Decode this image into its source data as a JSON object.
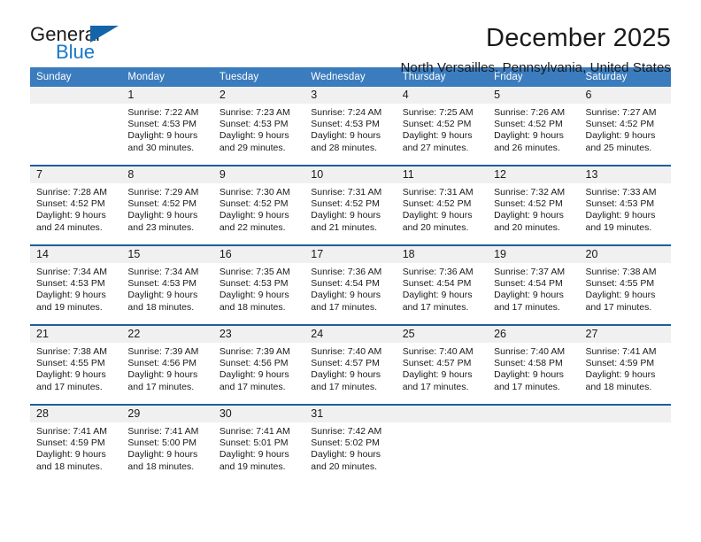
{
  "brand": {
    "name_part1": "General",
    "name_part2": "Blue",
    "accent_color": "#1878c8",
    "triangle_color": "#1464aa"
  },
  "header": {
    "title": "December 2025",
    "subtitle": "North Versailles, Pennsylvania, United States"
  },
  "theme": {
    "header_row_bg": "#3a7cbe",
    "row_rule": "#1b5f9e",
    "daynum_bg": "#f0f0f0",
    "text": "#1a1a1a"
  },
  "weekday_headers": [
    "Sunday",
    "Monday",
    "Tuesday",
    "Wednesday",
    "Thursday",
    "Friday",
    "Saturday"
  ],
  "weeks": [
    [
      {
        "day": "",
        "sunrise": "",
        "sunset": "",
        "daylight_line1": "",
        "daylight_line2": ""
      },
      {
        "day": "1",
        "sunrise": "Sunrise: 7:22 AM",
        "sunset": "Sunset: 4:53 PM",
        "daylight_line1": "Daylight: 9 hours",
        "daylight_line2": "and 30 minutes."
      },
      {
        "day": "2",
        "sunrise": "Sunrise: 7:23 AM",
        "sunset": "Sunset: 4:53 PM",
        "daylight_line1": "Daylight: 9 hours",
        "daylight_line2": "and 29 minutes."
      },
      {
        "day": "3",
        "sunrise": "Sunrise: 7:24 AM",
        "sunset": "Sunset: 4:53 PM",
        "daylight_line1": "Daylight: 9 hours",
        "daylight_line2": "and 28 minutes."
      },
      {
        "day": "4",
        "sunrise": "Sunrise: 7:25 AM",
        "sunset": "Sunset: 4:52 PM",
        "daylight_line1": "Daylight: 9 hours",
        "daylight_line2": "and 27 minutes."
      },
      {
        "day": "5",
        "sunrise": "Sunrise: 7:26 AM",
        "sunset": "Sunset: 4:52 PM",
        "daylight_line1": "Daylight: 9 hours",
        "daylight_line2": "and 26 minutes."
      },
      {
        "day": "6",
        "sunrise": "Sunrise: 7:27 AM",
        "sunset": "Sunset: 4:52 PM",
        "daylight_line1": "Daylight: 9 hours",
        "daylight_line2": "and 25 minutes."
      }
    ],
    [
      {
        "day": "7",
        "sunrise": "Sunrise: 7:28 AM",
        "sunset": "Sunset: 4:52 PM",
        "daylight_line1": "Daylight: 9 hours",
        "daylight_line2": "and 24 minutes."
      },
      {
        "day": "8",
        "sunrise": "Sunrise: 7:29 AM",
        "sunset": "Sunset: 4:52 PM",
        "daylight_line1": "Daylight: 9 hours",
        "daylight_line2": "and 23 minutes."
      },
      {
        "day": "9",
        "sunrise": "Sunrise: 7:30 AM",
        "sunset": "Sunset: 4:52 PM",
        "daylight_line1": "Daylight: 9 hours",
        "daylight_line2": "and 22 minutes."
      },
      {
        "day": "10",
        "sunrise": "Sunrise: 7:31 AM",
        "sunset": "Sunset: 4:52 PM",
        "daylight_line1": "Daylight: 9 hours",
        "daylight_line2": "and 21 minutes."
      },
      {
        "day": "11",
        "sunrise": "Sunrise: 7:31 AM",
        "sunset": "Sunset: 4:52 PM",
        "daylight_line1": "Daylight: 9 hours",
        "daylight_line2": "and 20 minutes."
      },
      {
        "day": "12",
        "sunrise": "Sunrise: 7:32 AM",
        "sunset": "Sunset: 4:52 PM",
        "daylight_line1": "Daylight: 9 hours",
        "daylight_line2": "and 20 minutes."
      },
      {
        "day": "13",
        "sunrise": "Sunrise: 7:33 AM",
        "sunset": "Sunset: 4:53 PM",
        "daylight_line1": "Daylight: 9 hours",
        "daylight_line2": "and 19 minutes."
      }
    ],
    [
      {
        "day": "14",
        "sunrise": "Sunrise: 7:34 AM",
        "sunset": "Sunset: 4:53 PM",
        "daylight_line1": "Daylight: 9 hours",
        "daylight_line2": "and 19 minutes."
      },
      {
        "day": "15",
        "sunrise": "Sunrise: 7:34 AM",
        "sunset": "Sunset: 4:53 PM",
        "daylight_line1": "Daylight: 9 hours",
        "daylight_line2": "and 18 minutes."
      },
      {
        "day": "16",
        "sunrise": "Sunrise: 7:35 AM",
        "sunset": "Sunset: 4:53 PM",
        "daylight_line1": "Daylight: 9 hours",
        "daylight_line2": "and 18 minutes."
      },
      {
        "day": "17",
        "sunrise": "Sunrise: 7:36 AM",
        "sunset": "Sunset: 4:54 PM",
        "daylight_line1": "Daylight: 9 hours",
        "daylight_line2": "and 17 minutes."
      },
      {
        "day": "18",
        "sunrise": "Sunrise: 7:36 AM",
        "sunset": "Sunset: 4:54 PM",
        "daylight_line1": "Daylight: 9 hours",
        "daylight_line2": "and 17 minutes."
      },
      {
        "day": "19",
        "sunrise": "Sunrise: 7:37 AM",
        "sunset": "Sunset: 4:54 PM",
        "daylight_line1": "Daylight: 9 hours",
        "daylight_line2": "and 17 minutes."
      },
      {
        "day": "20",
        "sunrise": "Sunrise: 7:38 AM",
        "sunset": "Sunset: 4:55 PM",
        "daylight_line1": "Daylight: 9 hours",
        "daylight_line2": "and 17 minutes."
      }
    ],
    [
      {
        "day": "21",
        "sunrise": "Sunrise: 7:38 AM",
        "sunset": "Sunset: 4:55 PM",
        "daylight_line1": "Daylight: 9 hours",
        "daylight_line2": "and 17 minutes."
      },
      {
        "day": "22",
        "sunrise": "Sunrise: 7:39 AM",
        "sunset": "Sunset: 4:56 PM",
        "daylight_line1": "Daylight: 9 hours",
        "daylight_line2": "and 17 minutes."
      },
      {
        "day": "23",
        "sunrise": "Sunrise: 7:39 AM",
        "sunset": "Sunset: 4:56 PM",
        "daylight_line1": "Daylight: 9 hours",
        "daylight_line2": "and 17 minutes."
      },
      {
        "day": "24",
        "sunrise": "Sunrise: 7:40 AM",
        "sunset": "Sunset: 4:57 PM",
        "daylight_line1": "Daylight: 9 hours",
        "daylight_line2": "and 17 minutes."
      },
      {
        "day": "25",
        "sunrise": "Sunrise: 7:40 AM",
        "sunset": "Sunset: 4:57 PM",
        "daylight_line1": "Daylight: 9 hours",
        "daylight_line2": "and 17 minutes."
      },
      {
        "day": "26",
        "sunrise": "Sunrise: 7:40 AM",
        "sunset": "Sunset: 4:58 PM",
        "daylight_line1": "Daylight: 9 hours",
        "daylight_line2": "and 17 minutes."
      },
      {
        "day": "27",
        "sunrise": "Sunrise: 7:41 AM",
        "sunset": "Sunset: 4:59 PM",
        "daylight_line1": "Daylight: 9 hours",
        "daylight_line2": "and 18 minutes."
      }
    ],
    [
      {
        "day": "28",
        "sunrise": "Sunrise: 7:41 AM",
        "sunset": "Sunset: 4:59 PM",
        "daylight_line1": "Daylight: 9 hours",
        "daylight_line2": "and 18 minutes."
      },
      {
        "day": "29",
        "sunrise": "Sunrise: 7:41 AM",
        "sunset": "Sunset: 5:00 PM",
        "daylight_line1": "Daylight: 9 hours",
        "daylight_line2": "and 18 minutes."
      },
      {
        "day": "30",
        "sunrise": "Sunrise: 7:41 AM",
        "sunset": "Sunset: 5:01 PM",
        "daylight_line1": "Daylight: 9 hours",
        "daylight_line2": "and 19 minutes."
      },
      {
        "day": "31",
        "sunrise": "Sunrise: 7:42 AM",
        "sunset": "Sunset: 5:02 PM",
        "daylight_line1": "Daylight: 9 hours",
        "daylight_line2": "and 20 minutes."
      },
      {
        "day": "",
        "sunrise": "",
        "sunset": "",
        "daylight_line1": "",
        "daylight_line2": ""
      },
      {
        "day": "",
        "sunrise": "",
        "sunset": "",
        "daylight_line1": "",
        "daylight_line2": ""
      },
      {
        "day": "",
        "sunrise": "",
        "sunset": "",
        "daylight_line1": "",
        "daylight_line2": ""
      }
    ]
  ]
}
